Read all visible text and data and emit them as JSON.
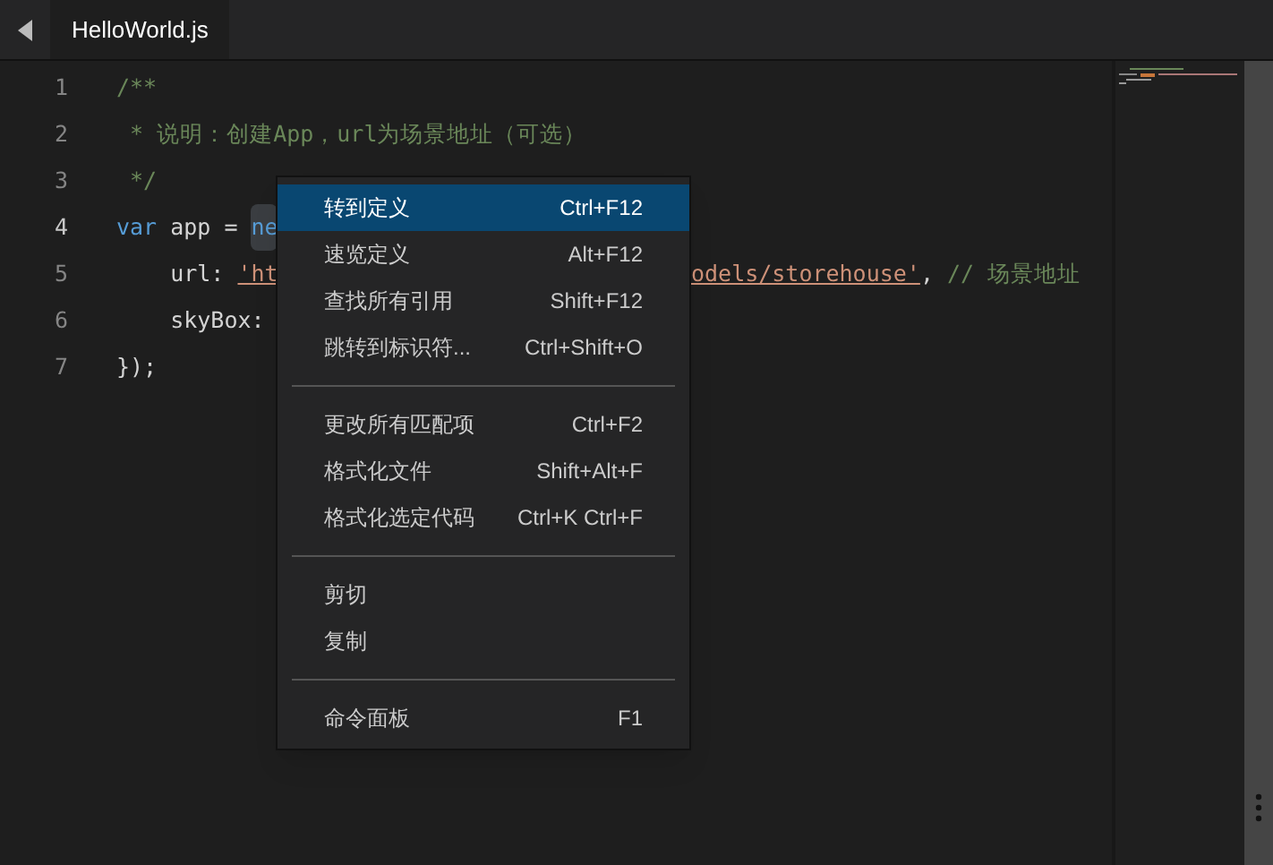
{
  "tabs": [
    {
      "label": "HelloWorld.js",
      "selected": true
    }
  ],
  "code_lines": [
    {
      "number": "1",
      "segments": [
        {
          "text": "/**",
          "kind": "comment"
        }
      ]
    },
    {
      "number": "2",
      "segments": [
        {
          "text": " * 说明：创建App，url为场景地址（可选）",
          "kind": "comment"
        }
      ]
    },
    {
      "number": "3",
      "segments": [
        {
          "text": " */",
          "kind": "comment"
        }
      ]
    },
    {
      "number": "4",
      "segments": [
        {
          "text": "var",
          "kind": "keyword"
        },
        {
          "text": " app = ",
          "kind": "plain"
        },
        {
          "text": "ne",
          "kind": "highlight"
        }
      ]
    },
    {
      "number": "5",
      "segments": [
        {
          "text": "    url: ",
          "kind": "plain"
        },
        {
          "text": "'ht",
          "kind": "string"
        }
      ],
      "after_menu": [
        {
          "text": "odels/storehouse'",
          "kind": "string"
        },
        {
          "text": ", ",
          "kind": "plain"
        },
        {
          "text": "// 场景地址",
          "kind": "comment"
        }
      ]
    },
    {
      "number": "6",
      "segments": [
        {
          "text": "    skyBox: ",
          "kind": "plain"
        }
      ]
    },
    {
      "number": "7",
      "segments": [
        {
          "text": "});",
          "kind": "plain"
        }
      ]
    }
  ],
  "context_menu": {
    "groups": [
      [
        {
          "label": "转到定义",
          "shortcut": "Ctrl+F12",
          "selected": true
        },
        {
          "label": "速览定义",
          "shortcut": "Alt+F12",
          "selected": false
        },
        {
          "label": "查找所有引用",
          "shortcut": "Shift+F12",
          "selected": false
        },
        {
          "label": "跳转到标识符...",
          "shortcut": "Ctrl+Shift+O",
          "selected": false
        }
      ],
      [
        {
          "label": "更改所有匹配项",
          "shortcut": "Ctrl+F2",
          "selected": false
        },
        {
          "label": "格式化文件",
          "shortcut": "Shift+Alt+F",
          "selected": false
        },
        {
          "label": "格式化选定代码",
          "shortcut": "Ctrl+K Ctrl+F",
          "selected": false
        }
      ],
      [
        {
          "label": "剪切",
          "selected": false
        },
        {
          "label": "复制",
          "selected": false
        }
      ],
      [
        {
          "label": "命令面板",
          "shortcut": "F1",
          "selected": false
        }
      ]
    ]
  }
}
